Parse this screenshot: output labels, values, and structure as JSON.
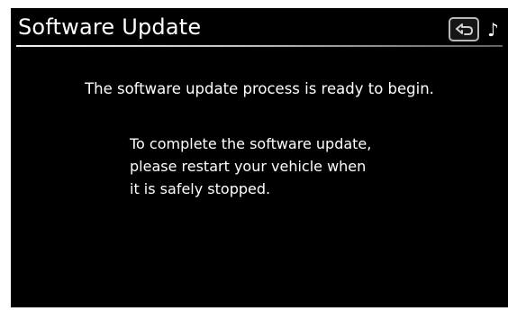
{
  "header": {
    "title": "Software Update",
    "back_icon": "back-arrow-icon",
    "audio_icon": "music-note-icon",
    "audio_glyph": "♪"
  },
  "body": {
    "status_text": "The software update process is ready to begin.",
    "instructions": [
      "To complete the software update,",
      "please restart your vehicle when",
      "it is safely stopped."
    ]
  },
  "colors": {
    "screen_bg": "#000000",
    "text": "#ffffff",
    "button_border": "#b8b8b8"
  }
}
